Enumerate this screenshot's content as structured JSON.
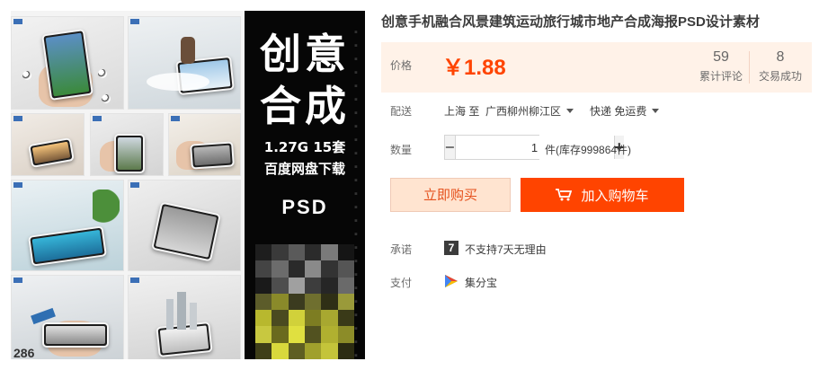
{
  "gallery": {
    "thumb_count_text": "286",
    "banner": {
      "line1": "创意",
      "line2": "合成",
      "size_sets": "1.27G  15套",
      "download": "百度网盘下载",
      "format": "PSD"
    },
    "mosaic_colors": [
      "#1e1e1e",
      "#3a3a3a",
      "#5a5a5a",
      "#2b2b2b",
      "#7a7a7a",
      "#151515",
      "#444",
      "#6c6c6c",
      "#2a2a2a",
      "#8a8a8a",
      "#333",
      "#555",
      "#1a1a1a",
      "#4e4e4e",
      "#a0a0a0",
      "#3d3d3d",
      "#262626",
      "#6a6a6a",
      "#5c5c2a",
      "#8a8a2a",
      "#3b3b1f",
      "#6f6f2f",
      "#2f2f16",
      "#9a9a3a",
      "#b8b82e",
      "#4a4a20",
      "#d1d13a",
      "#7d7d22",
      "#a8a830",
      "#3a3a18",
      "#c8c840",
      "#6a6a1e",
      "#e0e040",
      "#525220",
      "#b0b030",
      "#8c8c28",
      "#3e3e18",
      "#d8d83c",
      "#5e5e22",
      "#a0a02c",
      "#c4c43a",
      "#2c2c12"
    ]
  },
  "product": {
    "title": "创意手机融合风景建筑运动旅行城市地产合成海报PSD设计素材",
    "price_label": "价格",
    "price": "￥1.88",
    "reviews_count": "59",
    "reviews_label": "累计评论",
    "sales_count": "8",
    "sales_label": "交易成功",
    "shipping_label": "配送",
    "ship_from": "上海 至",
    "ship_to": "广西柳州柳江区",
    "shipping_method": "快递 免运费",
    "quantity_label": "数量",
    "quantity_value": "1",
    "stock_text": "件(库存999864件)",
    "buy_now_label": "立即购买",
    "add_to_cart_label": "加入购物车",
    "promise_label": "承诺",
    "promise_text": "不支持7天无理由",
    "payment_label": "支付",
    "payment_text": "集分宝"
  },
  "colors": {
    "accent": "#ff4400",
    "price_bg": "#fff2e8",
    "buy_now_bg": "#ffe4d0"
  }
}
